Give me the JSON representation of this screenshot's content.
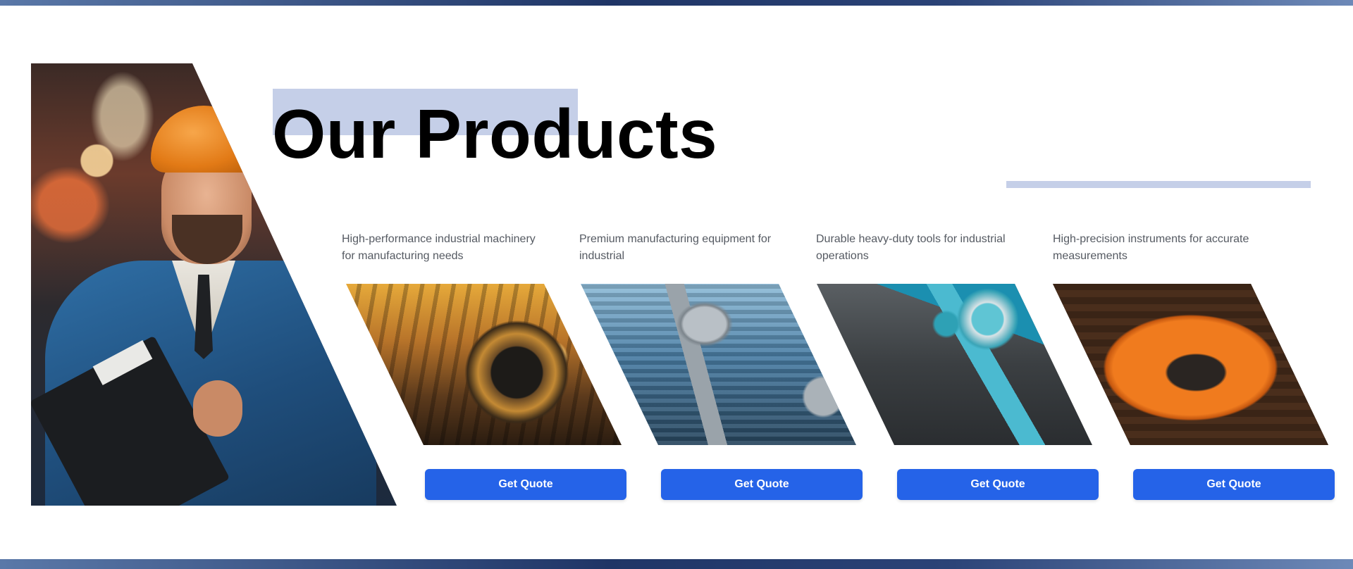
{
  "header": {
    "title": "Our Products"
  },
  "hero": {
    "image_name": "industrial-worker-photo"
  },
  "products": [
    {
      "description": "High-performance industrial machinery for manufacturing needs",
      "image": "industrial-machinery-photo",
      "button_label": "Get Quote"
    },
    {
      "description": "Premium manufacturing equipment for industrial",
      "image": "robotic-arm-photo",
      "button_label": "Get Quote"
    },
    {
      "description": "Durable heavy-duty tools for industrial operations",
      "image": "power-tools-set-photo",
      "button_label": "Get Quote"
    },
    {
      "description": "High-precision instruments for accurate measurements",
      "image": "orange-typewriter-photo",
      "button_label": "Get Quote"
    }
  ],
  "colors": {
    "accent_blue": "#2563e8",
    "highlight": "#c5cfe8",
    "band_dark": "#1f3566",
    "text_muted": "#555a62"
  }
}
